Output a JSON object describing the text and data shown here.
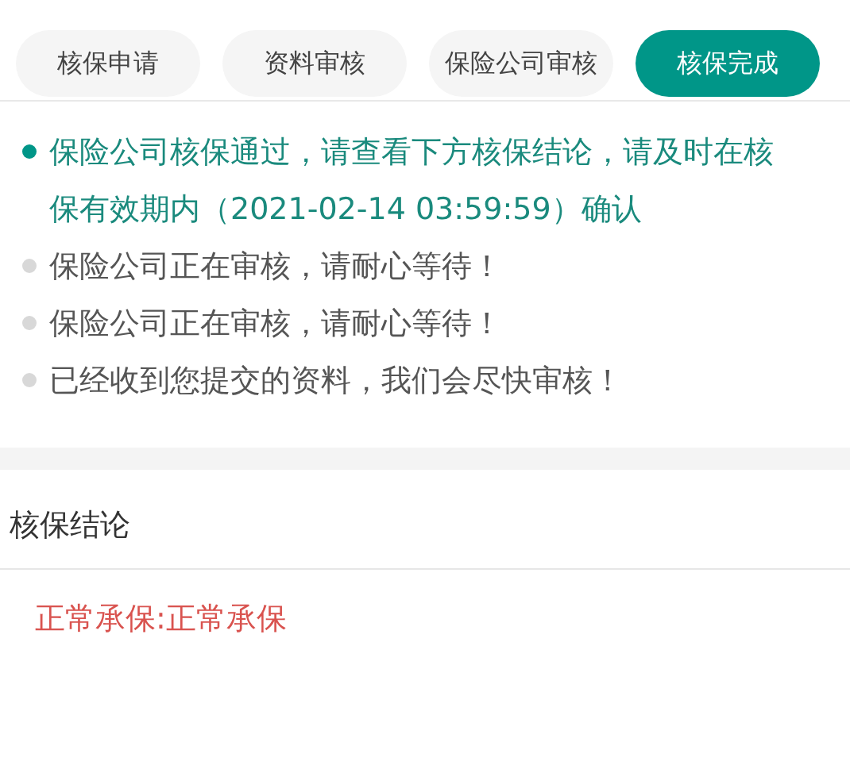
{
  "steps": [
    {
      "label": "核保申请",
      "selected": false
    },
    {
      "label": "资料审核",
      "selected": false
    },
    {
      "label": "保险公司审核",
      "selected": false
    },
    {
      "label": "核保完成",
      "selected": true
    }
  ],
  "timeline": [
    {
      "text": "保险公司核保通过，请查看下方核保结论，请及时在核保有效期内（2021-02-14 03:59:59）确认",
      "active": true
    },
    {
      "text": "保险公司正在审核，请耐心等待！",
      "active": false
    },
    {
      "text": "保险公司正在审核，请耐心等待！",
      "active": false
    },
    {
      "text": "已经收到您提交的资料，我们会尽快审核！",
      "active": false
    }
  ],
  "conclusion": {
    "title": "核保结论",
    "result": "正常承保:正常承保"
  }
}
